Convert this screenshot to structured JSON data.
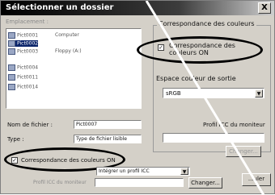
{
  "window": {
    "title": "Sélectionner un dossier",
    "close_glyph": "X"
  },
  "left": {
    "source_label": "Emplacement :",
    "folder_node": "Computer",
    "file_list": [
      "Pict0001",
      "Pict0002",
      "Pict0003",
      "Pict0004",
      "Pict0011",
      "Pict0014"
    ],
    "drive_node": "Floppy (A:)",
    "selected_index": 1,
    "filename_label": "Nom de fichier :",
    "filename_value": "Pict0007",
    "type_label": "Type :",
    "type_value": "Type de fichier lisible",
    "bottom_checkbox_label": "Correspondance des couleurs ON",
    "bottom_checkbox_checked": true,
    "bottom_profile_value": "Intégrer un profil ICC",
    "monitor_profile_label": "Profil ICC du moniteur",
    "change_button": "Changer..."
  },
  "right": {
    "group_title": "Correspondance des couleurs",
    "checkbox_label_line1": "Correspondance des",
    "checkbox_label_line2": "couleurs ON",
    "checkbox_checked": true,
    "output_space_label": "Espace couleur de sortie",
    "output_space_value": "sRGB",
    "monitor_profile_label": "Profil ICC du moniteur",
    "change_button": "Changer...",
    "ok_button_partial": "...uler"
  },
  "colors": {
    "highlight": "#0a246a",
    "face": "#d4d0c8"
  }
}
